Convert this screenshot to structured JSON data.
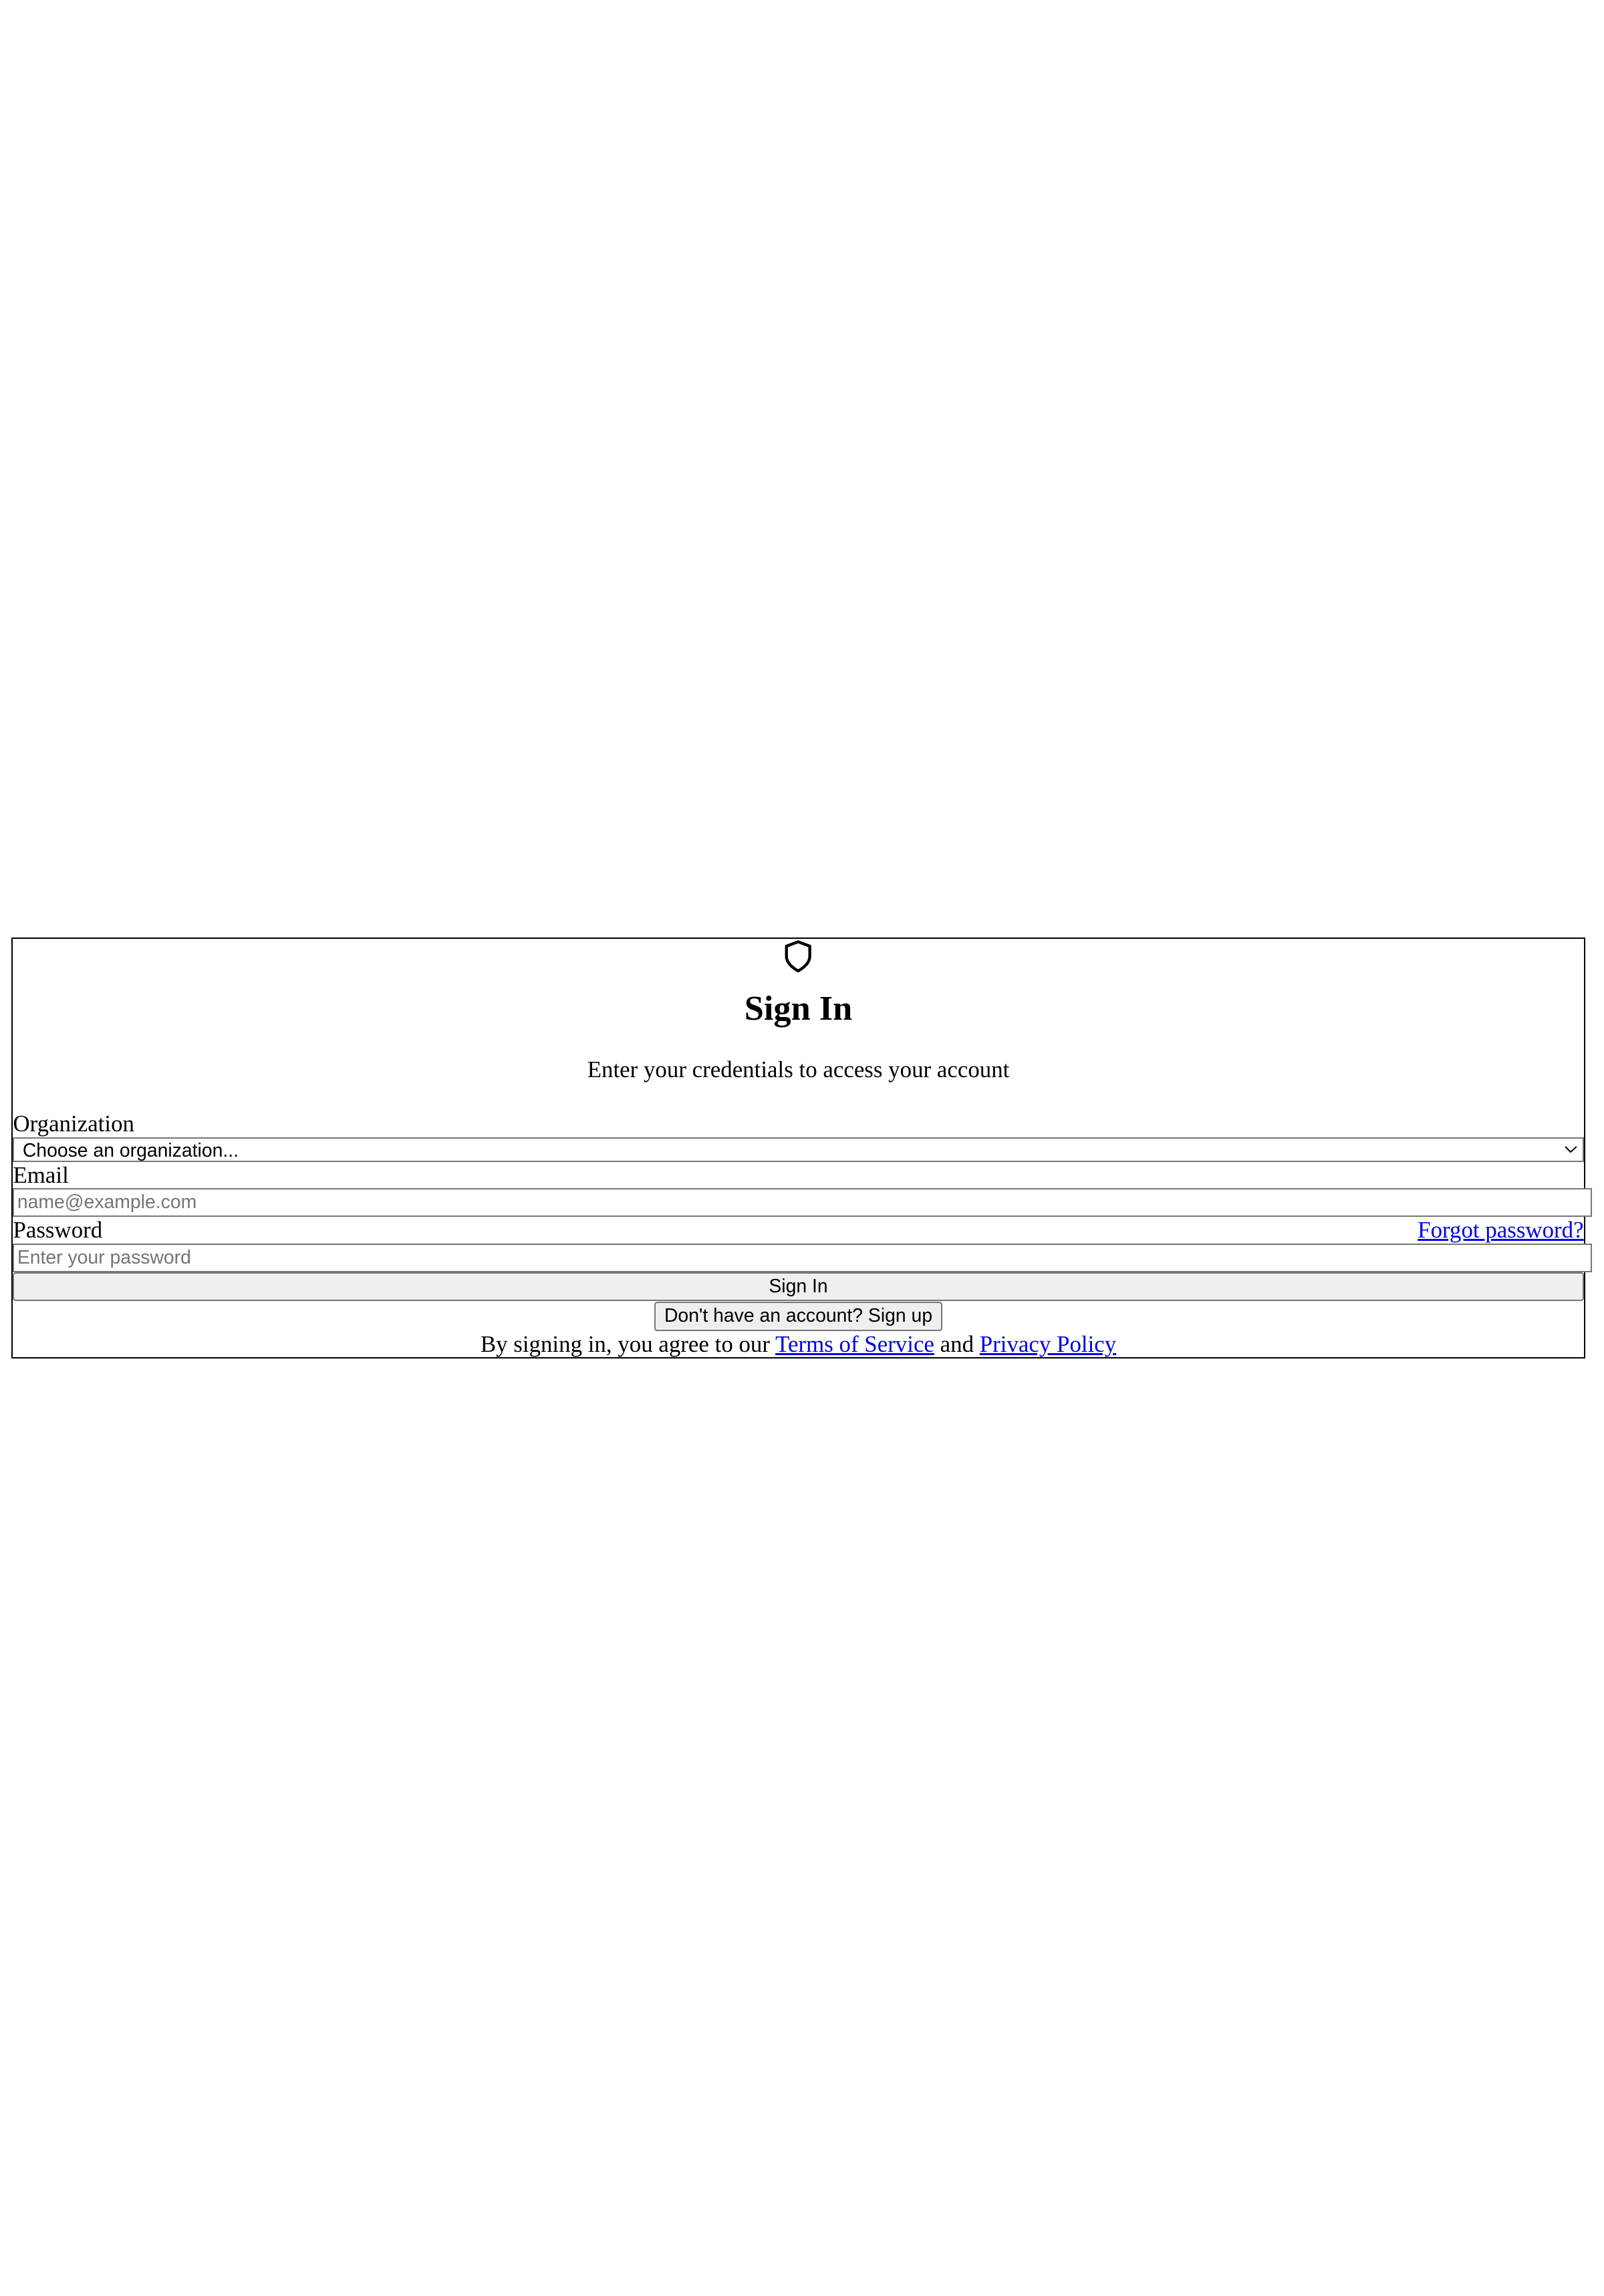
{
  "header": {
    "icon": "shield-icon",
    "title": "Sign In",
    "subtitle": "Enter your credentials to access your account"
  },
  "form": {
    "organization_label": "Organization",
    "organization_selected": "Choose an organization...",
    "email_label": "Email",
    "email_placeholder": "name@example.com",
    "password_label": "Password",
    "forgot_link": "Forgot password?",
    "password_placeholder": "Enter your password",
    "submit_label": "Sign In",
    "signup_label": "Don't have an account? Sign up"
  },
  "footer": {
    "prefix": "By signing in, you agree to our ",
    "terms": "Terms of Service",
    "and": " and ",
    "privacy": "Privacy Policy"
  }
}
